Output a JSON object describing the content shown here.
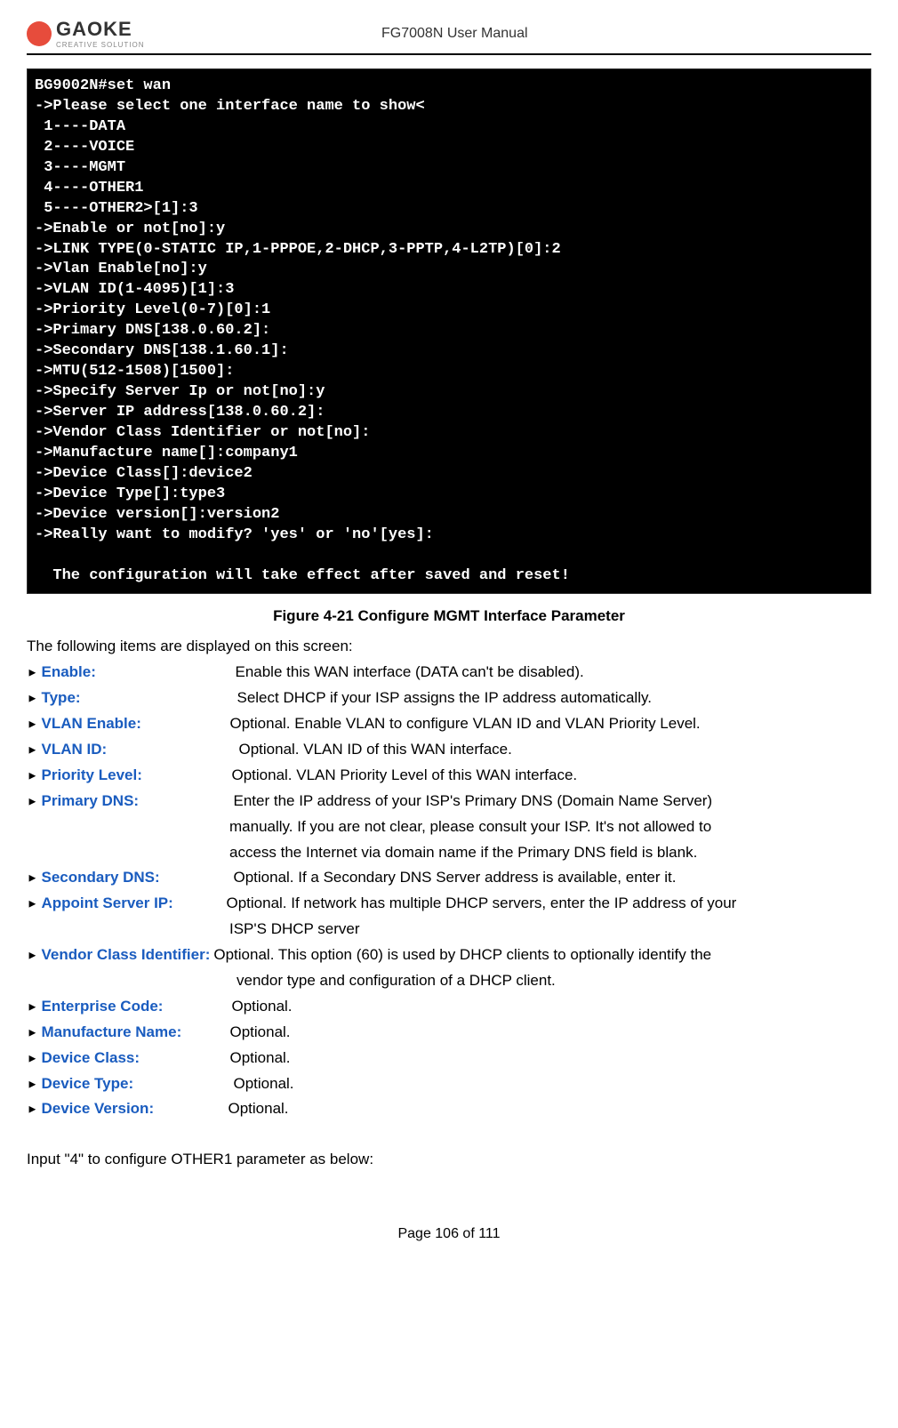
{
  "header": {
    "logo_text": "GAOKE",
    "logo_sub": "CREATIVE SOLUTION",
    "doc_title": "FG7008N User Manual"
  },
  "terminal": {
    "lines": [
      "BG9002N#set wan",
      "->Please select one interface name to show<",
      " 1----DATA",
      " 2----VOICE",
      " 3----MGMT",
      " 4----OTHER1",
      " 5----OTHER2>[1]:3",
      "->Enable or not[no]:y",
      "->LINK TYPE(0-STATIC IP,1-PPPOE,2-DHCP,3-PPTP,4-L2TP)[0]:2",
      "->Vlan Enable[no]:y",
      "->VLAN ID(1-4095)[1]:3",
      "->Priority Level(0-7)[0]:1",
      "->Primary DNS[138.0.60.2]:",
      "->Secondary DNS[138.1.60.1]:",
      "->MTU(512-1508)[1500]:",
      "->Specify Server Ip or not[no]:y",
      "->Server IP address[138.0.60.2]:",
      "->Vendor Class Identifier or not[no]:",
      "->Manufacture name[]:company1",
      "->Device Class[]:device2",
      "->Device Type[]:type3",
      "->Device version[]:version2",
      "->Really want to modify? 'yes' or 'no'[yes]:",
      "",
      "  The configuration will take effect after saved and reset!",
      ""
    ]
  },
  "figure_caption": "Figure 4-21  Configure MGMT Interface Parameter",
  "intro_text": "The following items are displayed on this screen:",
  "parameters": [
    {
      "label": "Enable:",
      "desc": "Enable this WAN interface (DATA can't be disabled).",
      "cont": []
    },
    {
      "label": "Type:",
      "desc": "Select DHCP if your ISP assigns the IP address automatically.",
      "cont": []
    },
    {
      "label": "VLAN Enable:",
      "desc": "Optional. Enable VLAN to configure VLAN ID and VLAN Priority Level.",
      "cont": []
    },
    {
      "label": "VLAN ID:",
      "desc": "Optional. VLAN ID of this WAN interface.",
      "cont": []
    },
    {
      "label": "Priority Level:",
      "desc": "Optional. VLAN Priority Level of this WAN interface.",
      "cont": []
    },
    {
      "label": "Primary DNS:",
      "desc": "Enter the IP address of your ISP's Primary DNS (Domain Name Server)",
      "cont": [
        "manually. If you are not clear, please consult your ISP. It's not allowed to",
        "access the Internet via domain name if the Primary DNS field is blank."
      ]
    },
    {
      "label": "Secondary DNS:",
      "desc": "Optional. If a Secondary DNS Server address is available, enter it.",
      "cont": []
    },
    {
      "label": "Appoint Server IP:",
      "desc": "Optional. If network has multiple DHCP servers, enter the IP address of your",
      "cont": [
        "ISP'S DHCP server"
      ]
    },
    {
      "label": "Vendor Class Identifier:",
      "desc": "Optional. This option (60) is used by DHCP clients to optionally identify the",
      "cont": [
        "vendor type and configuration of a DHCP client."
      ],
      "wide": true
    },
    {
      "label": "Enterprise Code:",
      "desc": "Optional.",
      "cont": []
    },
    {
      "label": "Manufacture Name:",
      "desc": "Optional.",
      "cont": []
    },
    {
      "label": "Device Class:",
      "desc": "Optional.",
      "cont": []
    },
    {
      "label": "Device Type:",
      "desc": "Optional.",
      "cont": []
    },
    {
      "label": "Device Version:",
      "desc": "Optional.",
      "cont": []
    }
  ],
  "bottom_text": "Input \"4\" to configure OTHER1 parameter as below:",
  "footer": "Page 106 of 111",
  "label_widths": {
    "Enable:": "218px",
    "Type:": "220px",
    "VLAN Enable:": "212px",
    "VLAN ID:": "222px",
    "Priority Level:": "214px",
    "Primary DNS:": "216px",
    "Secondary DNS:": "216px",
    "Appoint Server IP:": "208px",
    "Vendor Class Identifier:": "auto",
    "Enterprise Code:": "214px",
    "Manufacture Name:": "212px",
    "Device Class:": "212px",
    "Device Type:": "216px",
    "Device Version:": "210px"
  }
}
